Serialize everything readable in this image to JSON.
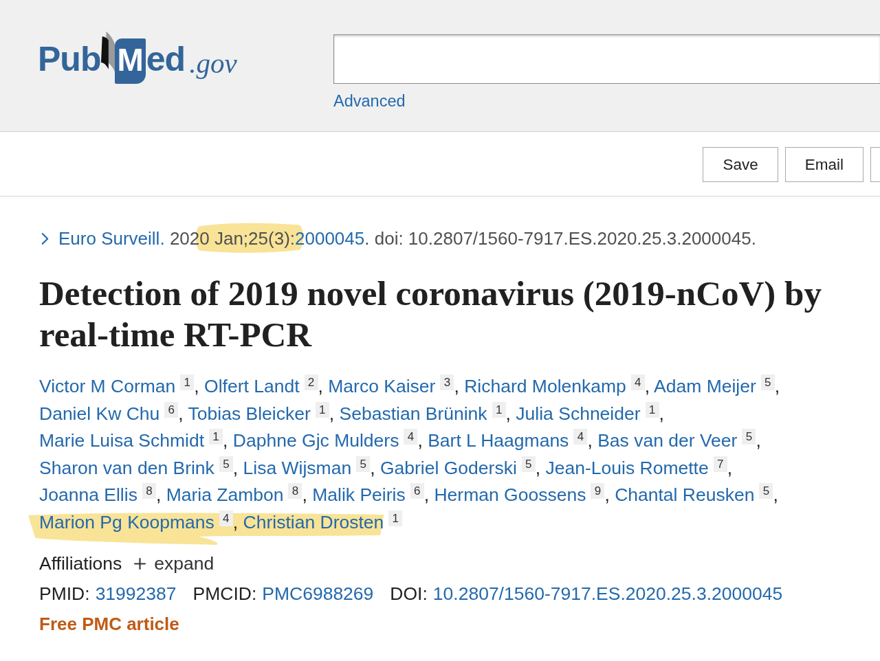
{
  "header": {
    "logo": {
      "left": "Pub",
      "page_letter": "M",
      "right": "ed",
      "domain": ".gov"
    },
    "advanced_link": "Advanced"
  },
  "actions": [
    {
      "label": "Save"
    },
    {
      "label": "Email"
    }
  ],
  "citation": {
    "journal": "Euro Surveill.",
    "date": "2020 Jan;25(3):",
    "article_number": "2000045",
    "doi": ". doi: 10.2807/1560-7917.ES.2020.25.3.2000045.",
    "highlighted": true
  },
  "title": "Detection of 2019 novel coronavirus (2019-nCoV) by real-time RT-PCR",
  "authors": [
    {
      "name": "Victor M Corman",
      "affiliation": "1",
      "separator": ",",
      "highlighted": false
    },
    {
      "name": "Olfert Landt",
      "affiliation": "2",
      "separator": ",",
      "highlighted": false
    },
    {
      "name": "Marco Kaiser",
      "affiliation": "3",
      "separator": ",",
      "highlighted": false
    },
    {
      "name": "Richard Molenkamp",
      "affiliation": "4",
      "separator": ",",
      "highlighted": false
    },
    {
      "name": "Adam Meijer",
      "affiliation": "5",
      "separator": ",",
      "highlighted": false
    },
    {
      "name": "Daniel Kw Chu",
      "affiliation": "6",
      "separator": ",",
      "highlighted": false
    },
    {
      "name": "Tobias Bleicker",
      "affiliation": "1",
      "separator": ",",
      "highlighted": false
    },
    {
      "name": "Sebastian Brünink",
      "affiliation": "1",
      "separator": ",",
      "highlighted": false
    },
    {
      "name": "Julia Schneider",
      "affiliation": "1",
      "separator": ",",
      "highlighted": false
    },
    {
      "name": "Marie Luisa Schmidt",
      "affiliation": "1",
      "separator": ",",
      "highlighted": false
    },
    {
      "name": "Daphne Gjc Mulders",
      "affiliation": "4",
      "separator": ",",
      "highlighted": false
    },
    {
      "name": "Bart L Haagmans",
      "affiliation": "4",
      "separator": ",",
      "highlighted": false
    },
    {
      "name": "Bas van der Veer",
      "affiliation": "5",
      "separator": ",",
      "highlighted": false
    },
    {
      "name": "Sharon van den Brink",
      "affiliation": "5",
      "separator": ",",
      "highlighted": false
    },
    {
      "name": "Lisa Wijsman",
      "affiliation": "5",
      "separator": ",",
      "highlighted": false
    },
    {
      "name": "Gabriel Goderski",
      "affiliation": "5",
      "separator": ",",
      "highlighted": false
    },
    {
      "name": "Jean-Louis Romette",
      "affiliation": "7",
      "separator": ",",
      "highlighted": false
    },
    {
      "name": "Joanna Ellis",
      "affiliation": "8",
      "separator": ",",
      "highlighted": false
    },
    {
      "name": "Maria Zambon",
      "affiliation": "8",
      "separator": ",",
      "highlighted": false
    },
    {
      "name": "Malik Peiris",
      "affiliation": "6",
      "separator": ",",
      "highlighted": false
    },
    {
      "name": "Herman Goossens",
      "affiliation": "9",
      "separator": ",",
      "highlighted": false
    },
    {
      "name": "Chantal Reusken",
      "affiliation": "5",
      "separator": ",",
      "highlighted": false
    },
    {
      "name": "Marion Pg Koopmans",
      "affiliation": "4",
      "separator": ",",
      "highlighted": true
    },
    {
      "name": "Christian Drosten",
      "affiliation": "1",
      "highlighted": true
    }
  ],
  "affiliations": {
    "label": "Affiliations",
    "toggle": "expand",
    "expanded": false
  },
  "identifiers": [
    {
      "label": "PMID:",
      "value": "31992387"
    },
    {
      "label": "PMCID:",
      "value": "PMC6988269"
    },
    {
      "label": "DOI:",
      "value": "10.2807/1560-7917.ES.2020.25.3.2000045"
    }
  ],
  "free_article": "Free PMC article"
}
